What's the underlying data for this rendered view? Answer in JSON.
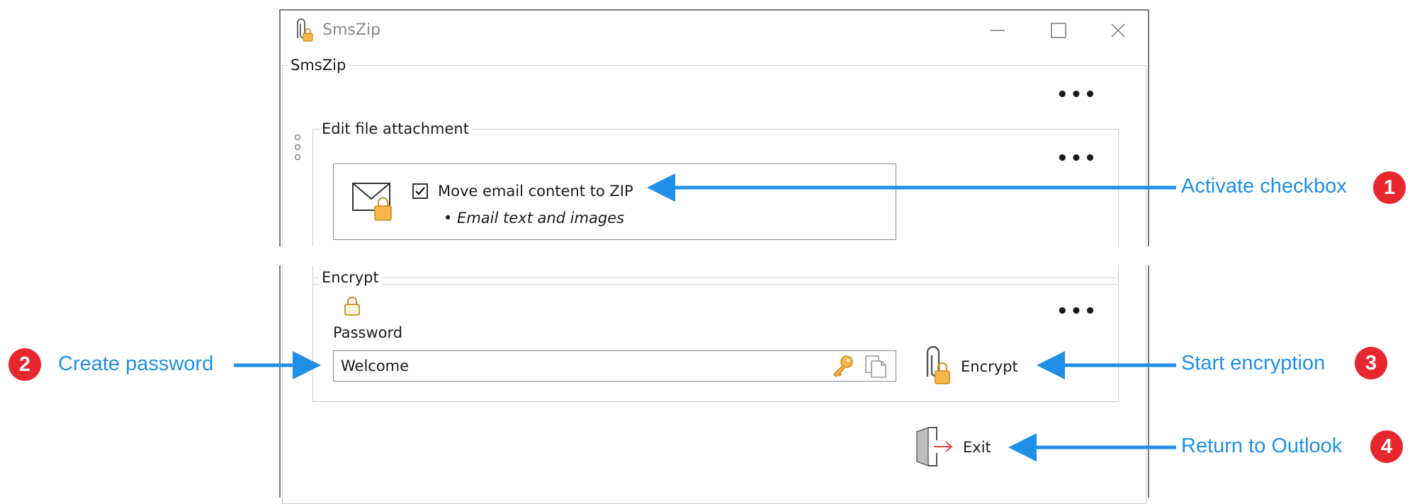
{
  "window": {
    "title": "SmsZip",
    "controls": [
      "minimize-icon",
      "maximize-icon",
      "close-icon"
    ]
  },
  "main_group": {
    "legend": "SmsZip"
  },
  "attachment_group": {
    "legend": "Edit file attachment",
    "checkbox_label": "Move email content to ZIP",
    "checkbox_checked": true,
    "bullet_text": "• Email text and images"
  },
  "encrypt_group": {
    "legend": "Encrypt",
    "password_label": "Password",
    "password_value": "Welcome",
    "encrypt_button": "Encrypt"
  },
  "exit_button": "Exit",
  "more_options": "•••",
  "annotations": [
    {
      "number": "1",
      "text": "Activate checkbox"
    },
    {
      "number": "2",
      "text": "Create password"
    },
    {
      "number": "3",
      "text": "Start encryption"
    },
    {
      "number": "4",
      "text": "Return to Outlook"
    }
  ],
  "colors": {
    "callout": "#1f8fe8",
    "badge": "#e8262d",
    "lock": "#f0a030",
    "window_border": "#7a7a7a"
  }
}
